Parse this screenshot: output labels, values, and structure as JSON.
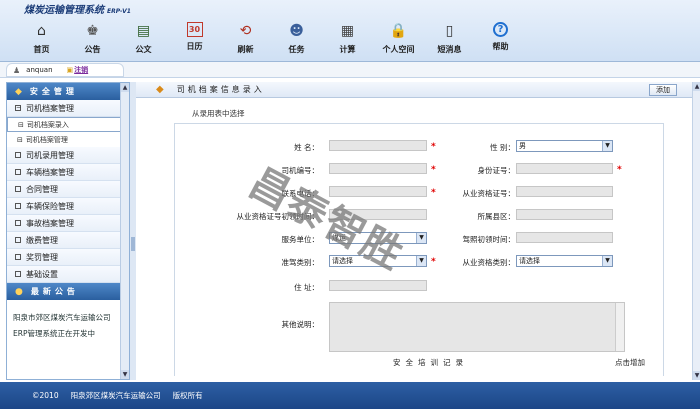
{
  "app": {
    "title": "煤炭运输管理系统",
    "version": "ERP-V1"
  },
  "toolbar": [
    {
      "label": "首页",
      "icon": "home-icon",
      "glyph": "⌂",
      "color": "#333333"
    },
    {
      "label": "公告",
      "icon": "announcement-icon",
      "glyph": "♚",
      "color": "#555555"
    },
    {
      "label": "公文",
      "icon": "document-icon",
      "glyph": "▤",
      "color": "#2d5d2a"
    },
    {
      "label": "日历",
      "icon": "calendar-icon",
      "glyph": "30",
      "color": "#c0392b"
    },
    {
      "label": "刷新",
      "icon": "refresh-icon",
      "glyph": "⟲",
      "color": "#b03020"
    },
    {
      "label": "任务",
      "icon": "task-icon",
      "glyph": "☻",
      "color": "#3a5f9a"
    },
    {
      "label": "计算",
      "icon": "calculator-icon",
      "glyph": "▦",
      "color": "#444444"
    },
    {
      "label": "个人空间",
      "icon": "lock-icon",
      "glyph": "🔒",
      "color": "#c0392b"
    },
    {
      "label": "短消息",
      "icon": "phone-icon",
      "glyph": "▯",
      "color": "#333333"
    },
    {
      "label": "帮助",
      "icon": "help-icon",
      "glyph": "?",
      "color": "#1f6fd0"
    }
  ],
  "user": {
    "name": "anquan",
    "logout": "注销"
  },
  "sidebar": {
    "safety_header": "安全管理",
    "items": [
      {
        "label": "司机档案管理",
        "expanded": true
      },
      {
        "label": "司机录用管理"
      },
      {
        "label": "车辆档案管理"
      },
      {
        "label": "合同管理"
      },
      {
        "label": "车辆保险管理"
      },
      {
        "label": "事故档案管理"
      },
      {
        "label": "缴费管理"
      },
      {
        "label": "奖罚管理"
      },
      {
        "label": "基础设置"
      }
    ],
    "sub_items": [
      "司机档案录入",
      "司机档案管理"
    ],
    "notice_header": "最新公告",
    "notice_text": "阳泉市郊区煤炭汽车运输公司ERP管理系统正在开发中"
  },
  "main": {
    "title": "司机档案信息录入",
    "add_button": "添加",
    "from_link": "从录用表中选择",
    "fields": {
      "name_label": "姓  名：",
      "gender_label": "性  别：",
      "gender_value": "男",
      "driver_no_label": "司机编号：",
      "id_no_label": "身份证号：",
      "phone_label": "联系电话：",
      "cert_no_label": "从业资格证号：",
      "cert_first_label": "从业资格证号初领时间：",
      "county_label": "所属县区：",
      "unit_label": "服务单位：",
      "unit_value": "煤运",
      "license_first_label": "驾照初领时间：",
      "license_type_label": "准驾类别：",
      "license_type_value": "请选择",
      "cert_type_label": "从业资格类别：",
      "cert_type_value": "请选择",
      "address_label": "住  址：",
      "remarks_label": "其他说明："
    },
    "section_title": "安全培训记录",
    "click_add": "点击增加"
  },
  "watermark": "昌泰智胜",
  "footer": {
    "copyright": "©2010",
    "company": "阳泉郊区煤炭汽车运输公司",
    "rights": "版权所有"
  }
}
